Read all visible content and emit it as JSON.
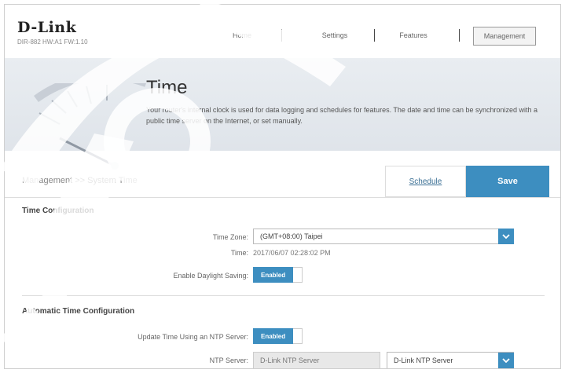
{
  "header": {
    "logo": "D-Link",
    "model": "DIR-882 HW:A1 FW:1.10",
    "nav": [
      {
        "label": "Home"
      },
      {
        "label": "Settings"
      },
      {
        "label": "Features"
      },
      {
        "label": "Management"
      }
    ]
  },
  "banner": {
    "title": "Time",
    "description": "Your router's internal clock is used for data logging and schedules for features. The date and time can be synchronized with a public time server on the Internet, or set manually."
  },
  "breadcrumb": {
    "text": "Management >> System Time",
    "schedule_label": "Schedule",
    "save_label": "Save"
  },
  "time_config": {
    "section_title": "Time Configuration",
    "time_zone_label": "Time Zone:",
    "time_zone_value": "(GMT+08:00) Taipei",
    "time_label": "Time:",
    "time_value": "2017/06/07 02:28:02 PM",
    "daylight_label": "Enable Daylight Saving:",
    "daylight_value": "Enabled"
  },
  "auto_time": {
    "section_title": "Automatic Time Configuration",
    "ntp_label": "Update Time Using an NTP Server:",
    "ntp_value": "Enabled",
    "ntp_server_label": "NTP Server:",
    "ntp_server_field": "D-Link NTP Server",
    "ntp_server_select": "D-Link NTP Server"
  },
  "colors": {
    "accent": "#3d8ec0",
    "link": "#3a6f94"
  }
}
